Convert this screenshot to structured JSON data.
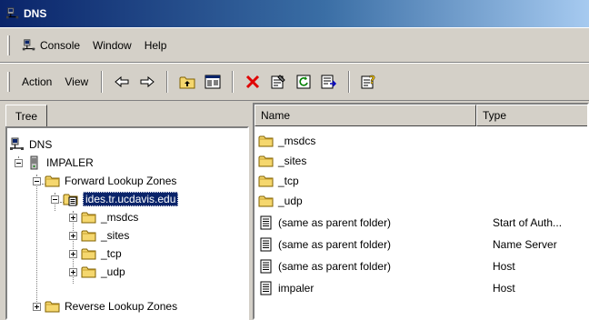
{
  "window": {
    "title": "DNS"
  },
  "menu": [
    {
      "label": "Console",
      "icon": "console-icon"
    },
    {
      "label": "Window"
    },
    {
      "label": "Help"
    }
  ],
  "toolbar": {
    "action_label": "Action",
    "view_label": "View"
  },
  "tree": {
    "tab_label": "Tree",
    "nodes": [
      {
        "label": "DNS",
        "icon": "dns-icon"
      },
      {
        "label": "IMPALER",
        "icon": "server-icon"
      },
      {
        "label": "Forward Lookup Zones",
        "icon": "folder-icon"
      },
      {
        "label": "ides.tr.ucdavis.edu",
        "icon": "zone-icon",
        "selected": true
      },
      {
        "label": "_msdcs",
        "icon": "folder-icon"
      },
      {
        "label": "_sites",
        "icon": "folder-icon"
      },
      {
        "label": "_tcp",
        "icon": "folder-icon"
      },
      {
        "label": "_udp",
        "icon": "folder-icon"
      },
      {
        "label": "Reverse Lookup Zones",
        "icon": "folder-icon"
      }
    ]
  },
  "list": {
    "columns": [
      "Name",
      "Type"
    ],
    "rows": [
      {
        "name": "_msdcs",
        "type": "",
        "icon": "folder-icon"
      },
      {
        "name": "_sites",
        "type": "",
        "icon": "folder-icon"
      },
      {
        "name": "_tcp",
        "type": "",
        "icon": "folder-icon"
      },
      {
        "name": "_udp",
        "type": "",
        "icon": "folder-icon"
      },
      {
        "name": "(same as parent folder)",
        "type": "Start of Auth...",
        "icon": "record-icon"
      },
      {
        "name": "(same as parent folder)",
        "type": "Name Server",
        "icon": "record-icon"
      },
      {
        "name": "(same as parent folder)",
        "type": "Host",
        "icon": "record-icon"
      },
      {
        "name": "impaler",
        "type": "Host",
        "icon": "record-icon"
      }
    ]
  },
  "colors": {
    "titlebar_start": "#0a246a",
    "titlebar_end": "#a6caf0",
    "face": "#d4d0c8",
    "folder": "#f5d76e",
    "selection": "#0a246a"
  }
}
